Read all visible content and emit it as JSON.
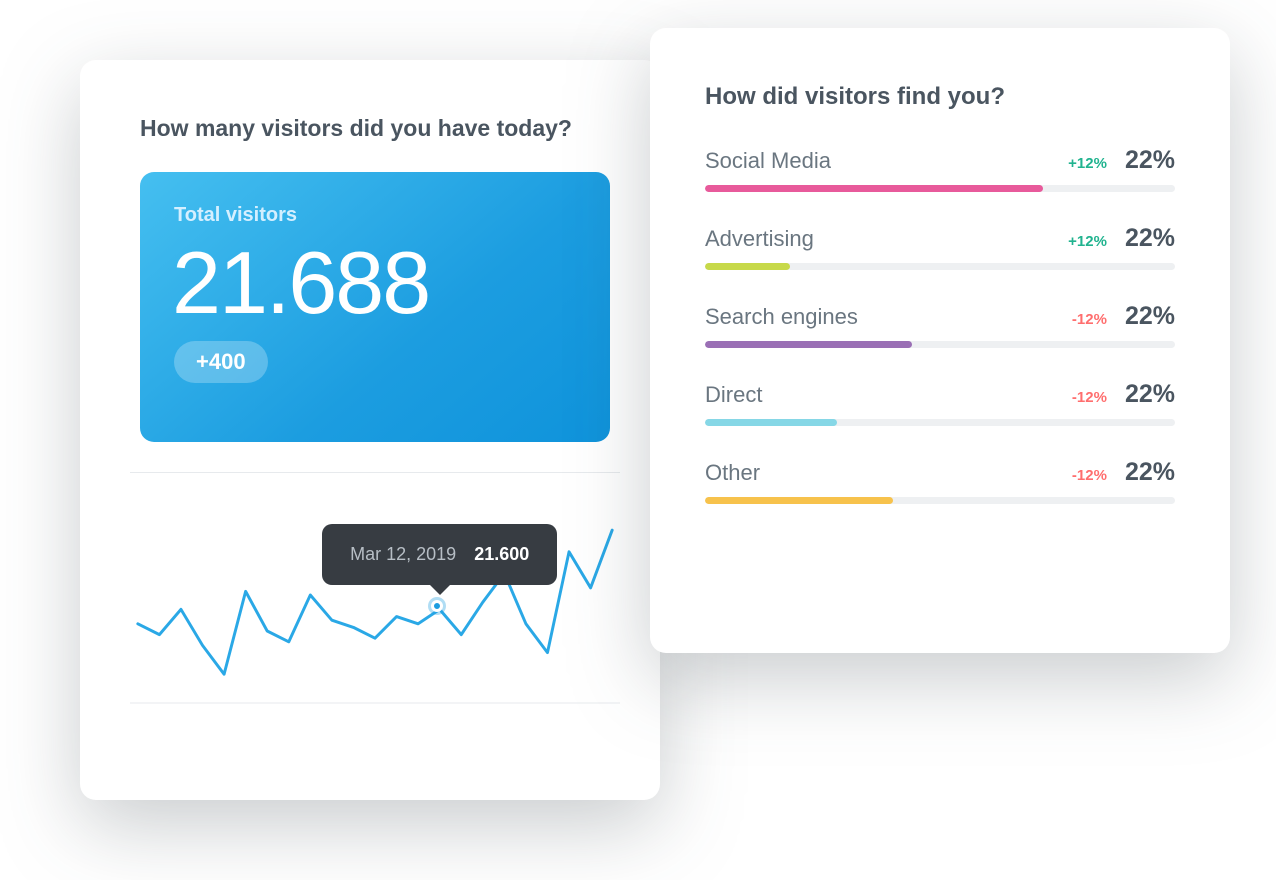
{
  "visitors_card": {
    "title": "How many visitors did you have today?",
    "tile_label": "Total visitors",
    "tile_value": "21.688",
    "tile_delta": "+400",
    "tooltip_date": "Mar 12, 2019",
    "tooltip_value": "21.600"
  },
  "sources_card": {
    "title": "How did visitors find you?",
    "rows": [
      {
        "name": "Social Media",
        "delta": "+12%",
        "dir": "up",
        "pct": "22%",
        "fill": 72,
        "color": "#e85a9b"
      },
      {
        "name": "Advertising",
        "delta": "+12%",
        "dir": "up",
        "pct": "22%",
        "fill": 18,
        "color": "#c7d94a"
      },
      {
        "name": "Search engines",
        "delta": "-12%",
        "dir": "down",
        "pct": "22%",
        "fill": 44,
        "color": "#9a6fb5"
      },
      {
        "name": "Direct",
        "delta": "-12%",
        "dir": "down",
        "pct": "22%",
        "fill": 28,
        "color": "#86d7e6"
      },
      {
        "name": "Other",
        "delta": "-12%",
        "dir": "down",
        "pct": "22%",
        "fill": 40,
        "color": "#f7c24c"
      }
    ]
  },
  "chart_data": {
    "type": "line",
    "title": "Total visitors",
    "xlabel": "",
    "ylabel": "",
    "ylim": [
      19000,
      24000
    ],
    "x": [
      0,
      1,
      2,
      3,
      4,
      5,
      6,
      7,
      8,
      9,
      10,
      11,
      12,
      13,
      14,
      15,
      16,
      17,
      18,
      19,
      20,
      21,
      22
    ],
    "values": [
      21200,
      20900,
      21600,
      20600,
      19800,
      22100,
      21000,
      20700,
      22000,
      21300,
      21100,
      20800,
      21400,
      21200,
      21600,
      20900,
      21800,
      22600,
      21200,
      20400,
      23200,
      22200,
      23800
    ],
    "highlight": {
      "index": 14,
      "label": "Mar 12, 2019",
      "value": 21600
    },
    "stroke_color": "#2aa8e6"
  }
}
